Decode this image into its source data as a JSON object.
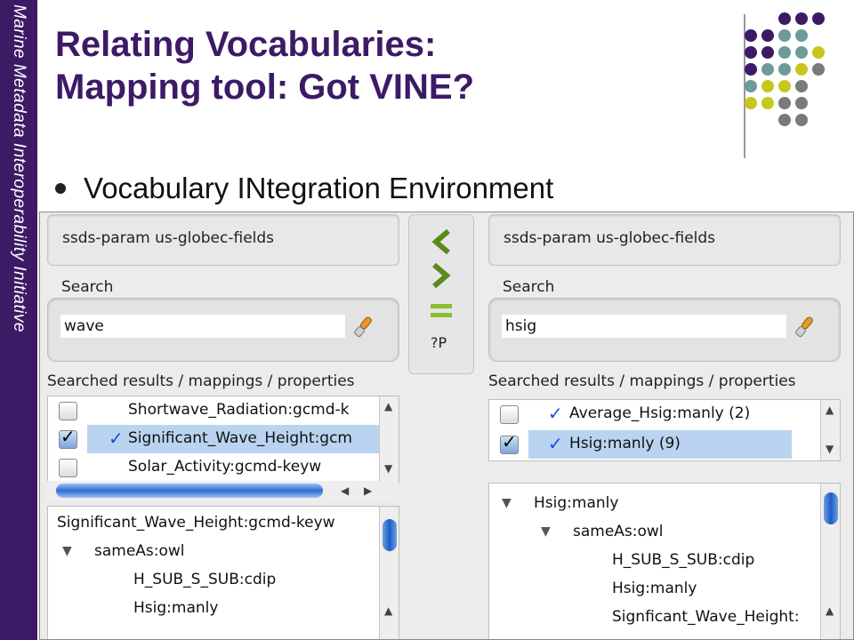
{
  "slide": {
    "side_text": "Marine Metadata Interoperability Initiative",
    "title_line1": "Relating Vocabularies:",
    "title_line2": "Mapping tool: Got VINE?",
    "bullet": "Vocabulary INtegration Environment"
  },
  "colors": {
    "brand_purple": "#3d1a66",
    "dot_teal": "#6e9a9a",
    "dot_olive": "#c7c720",
    "dot_gray": "#7a7a7a"
  },
  "app": {
    "left": {
      "vocabularies": "ssds-param  us-globec-fields",
      "search_label": "Search",
      "search_value": "wave",
      "results_label": "Searched results / mappings / properties",
      "results": [
        {
          "text": "Shortwave_Radiation:gcmd-k",
          "checked": false,
          "mapped": false
        },
        {
          "text": "Significant_Wave_Height:gcm",
          "checked": true,
          "mapped": true
        },
        {
          "text": "Solar_Activity:gcmd-keyw",
          "checked": false,
          "mapped": false
        }
      ],
      "tree_root": "Significant_Wave_Height:gcmd-keyw",
      "tree_relation": "sameAs:owl",
      "tree_children": [
        "H_SUB_S_SUB:cdip",
        "Hsig:manly"
      ]
    },
    "middle": {
      "btn_left": "<",
      "btn_right": ">",
      "btn_equal": "=",
      "btn_property": "?P"
    },
    "right": {
      "vocabularies": "ssds-param  us-globec-fields",
      "search_label": "Search",
      "search_value": "hsig",
      "results_label": "Searched results / mappings / properties",
      "results": [
        {
          "text": "Average_Hsig:manly (2)",
          "checked": false,
          "mapped": true
        },
        {
          "text": "Hsig:manly (9)",
          "checked": true,
          "mapped": true
        }
      ],
      "tree_root": "Hsig:manly",
      "tree_relation": "sameAs:owl",
      "tree_children": [
        "H_SUB_S_SUB:cdip",
        "Hsig:manly",
        "Signficant_Wave_Height:"
      ]
    },
    "icons": {
      "search": "wrench-brush-icon",
      "check": "checkmark-icon",
      "expand": "triangle-down-icon"
    }
  }
}
